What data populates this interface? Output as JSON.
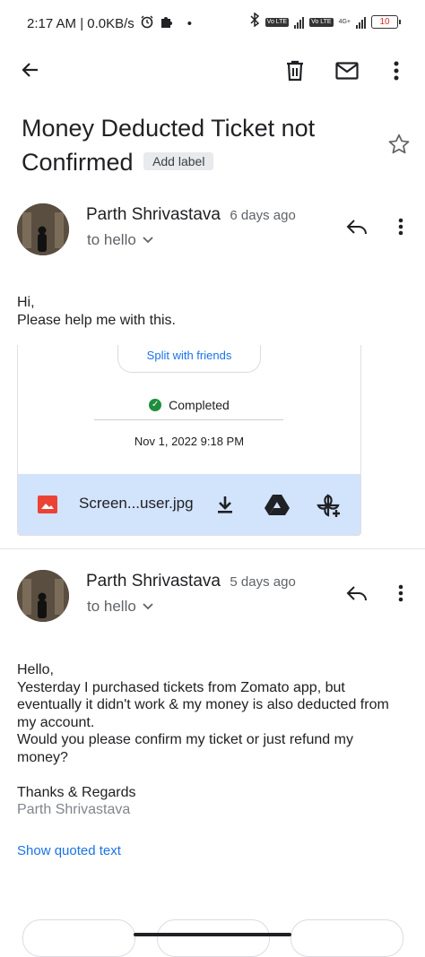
{
  "status_bar": {
    "time": "2:17 AM | 0.0KB/s",
    "battery": "10",
    "volte1": "Vo LTE",
    "volte2": "Vo LTE",
    "net": "4G+"
  },
  "email": {
    "subject": "Money Deducted Ticket not Confirmed",
    "label_button": "Add label"
  },
  "messages": [
    {
      "sender": "Parth Shrivastava",
      "time": "6 days ago",
      "recipient": "to hello",
      "body": [
        "Hi,",
        "Please help me with this."
      ]
    },
    {
      "sender": "Parth Shrivastava",
      "time": "5 days ago",
      "recipient": "to hello",
      "body": [
        "Hello,",
        "Yesterday I purchased tickets from Zomato app, but",
        "eventually it didn't work & my money is also deducted from",
        "my account.",
        "Would you please confirm my ticket or just refund my",
        "money?",
        "",
        "Thanks & Regards"
      ],
      "signature": "Parth Shrivastava",
      "show_quoted": "Show quoted text"
    }
  ],
  "attachment": {
    "split_label": "Split with friends",
    "status": "Completed",
    "date": "Nov 1, 2022 9:18 PM",
    "file_name": "Screen...user.jpg"
  },
  "colors": {
    "accent": "#1a73e8",
    "attachment_bar": "#d2e3fc",
    "status_green": "#1e8e3e"
  }
}
